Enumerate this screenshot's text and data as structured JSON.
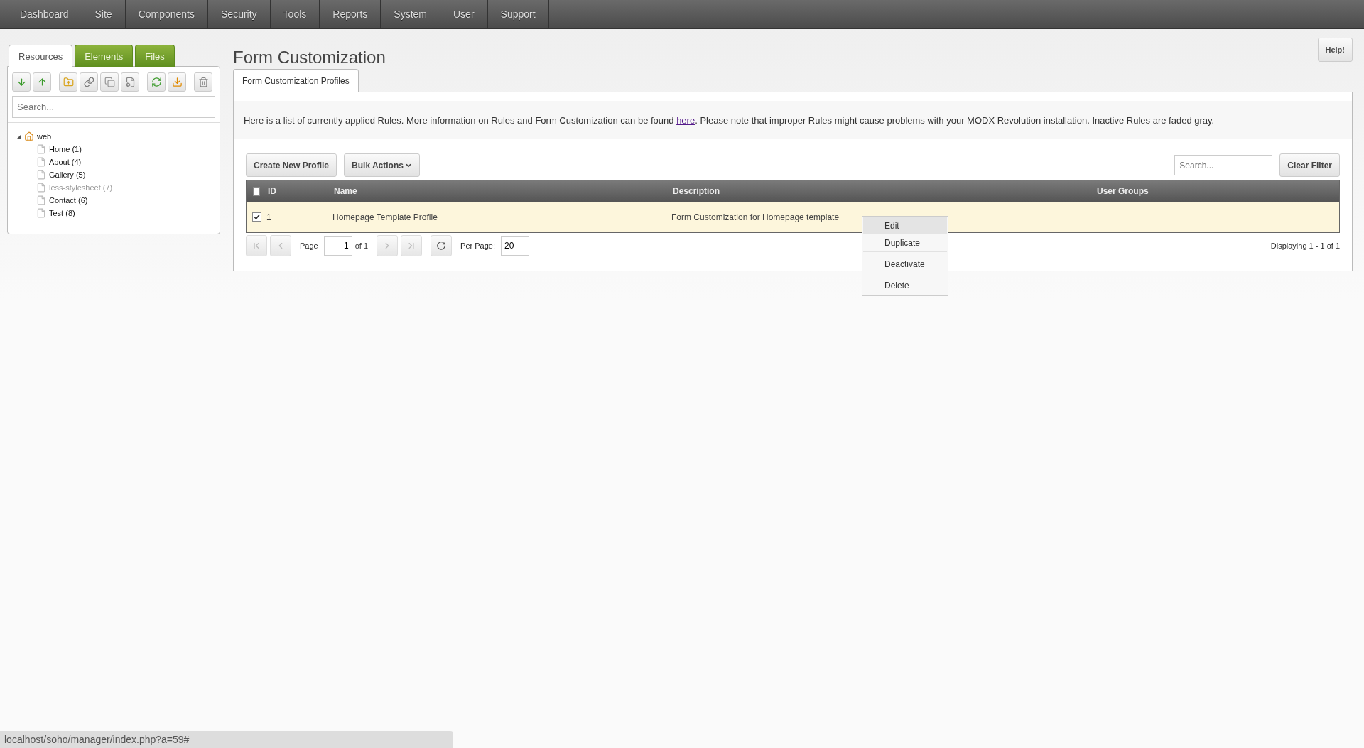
{
  "nav": [
    "Dashboard",
    "Site",
    "Components",
    "Security",
    "Tools",
    "Reports",
    "System",
    "User",
    "Support"
  ],
  "sidebar": {
    "tabs": [
      {
        "label": "Resources",
        "selected": true
      },
      {
        "label": "Elements",
        "selected": false
      },
      {
        "label": "Files",
        "selected": false
      }
    ],
    "search": {
      "placeholder": "Search..."
    },
    "tree": {
      "label": "web",
      "expanded": true,
      "children": [
        {
          "label": "Home (1)",
          "published": true
        },
        {
          "label": "About (4)",
          "published": true
        },
        {
          "label": "Gallery (5)",
          "published": true
        },
        {
          "label": "less-stylesheet (7)",
          "published": false
        },
        {
          "label": "Contact (6)",
          "published": true
        },
        {
          "label": "Test (8)",
          "published": true
        }
      ]
    }
  },
  "page": {
    "title": "Form Customization",
    "help_button": "Help!",
    "tabs": [
      {
        "label": "Form Customization Profiles",
        "selected": true
      }
    ],
    "intro": {
      "before": "Here is a list of currently applied Rules. More information on Rules and Form Customization can be found ",
      "link": "here",
      "after": ". Please note that improper Rules might cause problems with your MODX Revolution installation. Inactive Rules are faded gray."
    },
    "buttons": [
      {
        "label": "Create New Profile",
        "dropdown": false
      },
      {
        "label": "Bulk Actions",
        "dropdown": true
      }
    ],
    "search": {
      "placeholder": "Search..."
    },
    "clear_filter": "Clear Filter",
    "table": {
      "all_checked": false,
      "columns": [
        "ID",
        "Name",
        "Description",
        "User Groups"
      ],
      "rows": [
        {
          "checked": true,
          "id": "1",
          "name": "Homepage Template Profile",
          "description": "Form Customization for Homepage template"
        }
      ]
    },
    "pagination": {
      "page_label": "Page",
      "page": "1",
      "of": "of 1",
      "per_page_label": "Per Page:",
      "per_page": "20",
      "display": "Displaying 1 - 1 of 1"
    },
    "context_menu": [
      {
        "label": "Edit",
        "selected": true,
        "divider_after": false
      },
      {
        "label": "Duplicate",
        "selected": false,
        "divider_after": true
      },
      {
        "label": "Deactivate",
        "selected": false,
        "divider_after": true
      },
      {
        "label": "Delete",
        "selected": false,
        "divider_after": false
      }
    ]
  },
  "status_bar": {
    "url": "localhost/soho/manager/index.php?a=59#"
  }
}
